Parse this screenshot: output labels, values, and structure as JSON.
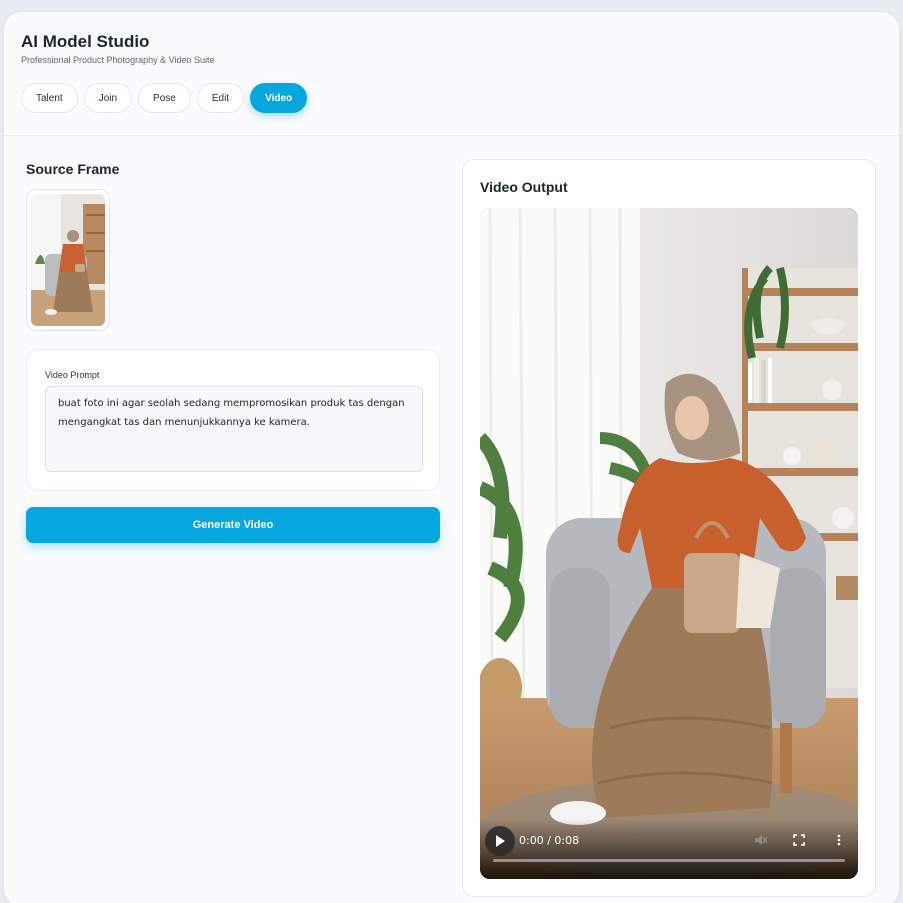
{
  "app": {
    "title": "AI Model Studio",
    "subtitle": "Professional Product Photography & Video Suite"
  },
  "tabs": [
    {
      "label": "Talent",
      "active": false
    },
    {
      "label": "Join",
      "active": false
    },
    {
      "label": "Pose",
      "active": false
    },
    {
      "label": "Edit",
      "active": false
    },
    {
      "label": "Video",
      "active": true
    }
  ],
  "source_frame": {
    "title": "Source Frame",
    "thumbnail_icon": "source-image-thumbnail"
  },
  "prompt": {
    "label": "Video Prompt",
    "value": "buat foto ini agar seolah sedang mempromosikan produk tas dengan mengangkat tas dan menunjukkannya ke kamera."
  },
  "generate_button": {
    "label": "Generate Video"
  },
  "output": {
    "title": "Video Output",
    "player": {
      "time": "0:00 / 0:08",
      "progress": 0,
      "icons": [
        "play-icon",
        "mute-icon",
        "fullscreen-icon",
        "more-options-icon"
      ]
    }
  },
  "colors": {
    "accent": "#06a6df",
    "background": "#f9fbfd"
  }
}
